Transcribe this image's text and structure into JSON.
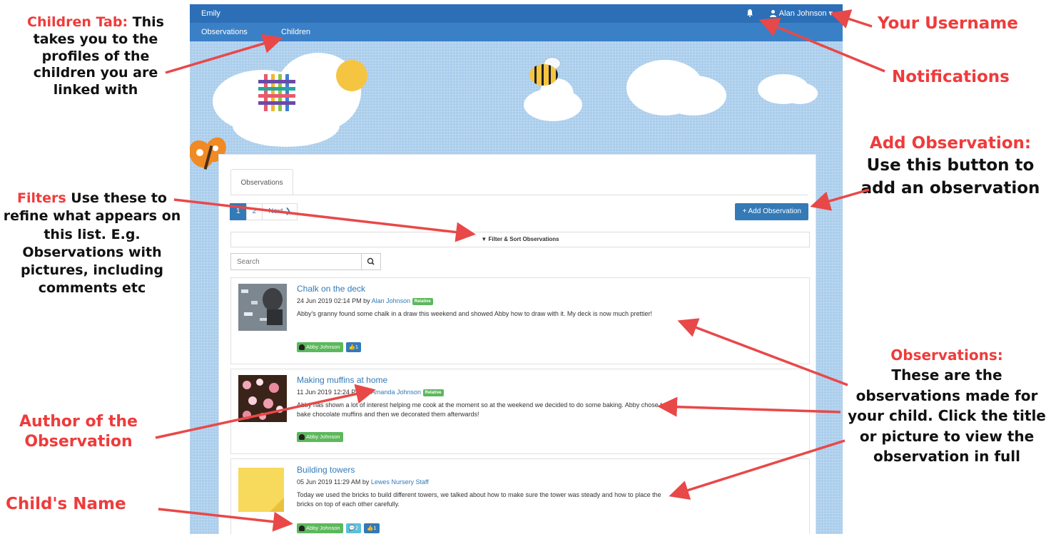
{
  "app": {
    "brand": "Emily",
    "nav": {
      "observations": "Observations",
      "children": "Children"
    },
    "user": {
      "name": "Alan Johnson",
      "caret": "▾"
    },
    "tab": "Observations",
    "pagination": {
      "pages": [
        "1",
        "2"
      ],
      "next": "Next ❯"
    },
    "add_button": "+ Add Observation",
    "filter_label": "▼ Filter & Sort Observations",
    "search_placeholder": "Search"
  },
  "observations": [
    {
      "title": "Chalk on the deck",
      "date": "24 Jun 2019 02:14 PM by ",
      "author": "Alan Johnson",
      "badge": "Relative",
      "body": "Abby's granny found some chalk in a draw this weekend and showed Abby how to draw with it. My deck is now much prettier!",
      "child": "Abby Johnson",
      "likes": "1"
    },
    {
      "title": "Making muffins at home",
      "date": "11 Jun 2019 12:24 PM by ",
      "author": "Amanda Johnson",
      "badge": "Relative",
      "body": "Abby has shown a lot of interest helping me cook at the moment so at the weekend we decided to do some baking. Abby chose to bake chocolate muffins and then we decorated them afterwards!",
      "child": "Abby Johnson"
    },
    {
      "title": "Building towers",
      "date": "05 Jun 2019 11:29 AM by ",
      "author": "Lewes Nursery Staff",
      "body": "Today we used the bricks to build different towers, we talked about how to make sure the tower was steady and how to place the bricks on top of each other carefully.",
      "child": "Abby Johnson",
      "comments": "2",
      "likes": "1"
    }
  ],
  "annotations": {
    "children_tab": {
      "heading": "Children Tab:",
      "text": " This takes you to the profiles of the children you are linked with"
    },
    "filters": {
      "heading": "Filters",
      "text": "  Use these to refine what appears on this list. E.g. Observations with pictures, including comments etc"
    },
    "author": "Author of the Observation",
    "child_name": "Child's Name",
    "username": "Your Username",
    "notifications": "Notifications",
    "add_observation": {
      "heading": "Add Observation:",
      "text": "Use this button to add an observation"
    },
    "observations": {
      "heading": "Observations:",
      "text": "These are the observations made for your child. Click the title or picture to view the observation in full"
    }
  },
  "colors": {
    "nav": "#2c6fb7",
    "primary": "#337ab7",
    "success": "#5cb85c",
    "info": "#5bc0de",
    "annotation": "#ef3b3b"
  }
}
